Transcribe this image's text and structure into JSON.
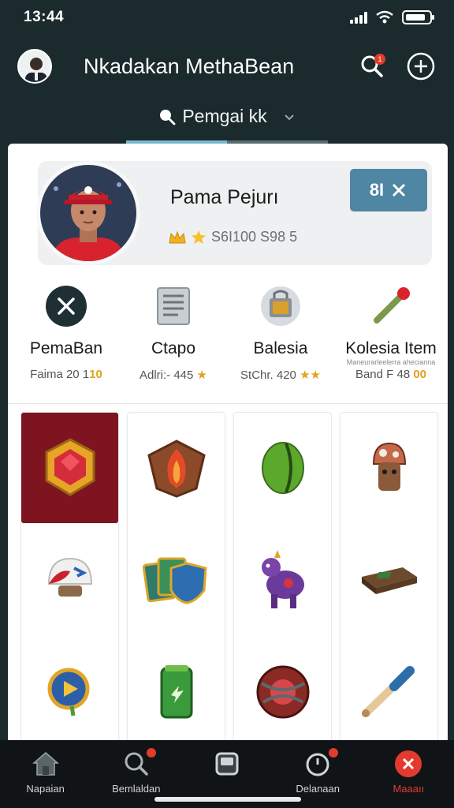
{
  "status": {
    "time": "13:44"
  },
  "header": {
    "title": "Nkadakan MethaBean",
    "notif_badge": "1"
  },
  "search": {
    "label": "Pemgai kk"
  },
  "profile": {
    "name": "Pama Pejurı",
    "stats": "S6I100 S98 5",
    "action_label": "8I"
  },
  "categories": [
    {
      "name": "PemaBan",
      "sub": "Faima 20 1",
      "sub_accent": "10",
      "icon": "close-circle-icon"
    },
    {
      "name": "Ctapo",
      "sub": "Adlri:- 445",
      "sub_accent": "★",
      "icon": "document-icon"
    },
    {
      "name": "Balesia",
      "sub": "StChr. 420",
      "sub_accent": "★★",
      "icon": "vault-icon"
    },
    {
      "name": "Kolesia Item",
      "sub": "Band F 48",
      "sub_accent": "00",
      "sub_small": "Maneurarleelerra ahecianna",
      "icon": "cricket-bat-icon"
    }
  ],
  "items": [
    {
      "icon": "gold-emblem-icon",
      "selected": true
    },
    {
      "icon": "flame-shield-icon"
    },
    {
      "icon": "green-ball-icon"
    },
    {
      "icon": "mushroom-figure-icon"
    },
    {
      "icon": "helmet-icon"
    },
    {
      "icon": "card-shield-icon"
    },
    {
      "icon": "purple-creature-icon"
    },
    {
      "icon": "wooden-board-icon"
    },
    {
      "icon": "medal-icon"
    },
    {
      "icon": "green-can-icon"
    },
    {
      "icon": "red-ball-icon"
    },
    {
      "icon": "bat-icon"
    }
  ],
  "bottom_nav": [
    {
      "label": "Napaian",
      "icon": "home-icon"
    },
    {
      "label": "Bemlaldan",
      "icon": "search-icon",
      "badge": true
    },
    {
      "label": "",
      "icon": "square-icon"
    },
    {
      "label": "Delanaan",
      "icon": "timer-icon",
      "badge": true
    },
    {
      "label": "Maaaıı",
      "icon": "close-badge-icon",
      "active": true
    }
  ],
  "colors": {
    "background": "#1b2a2c",
    "accent_red": "#e23b2e",
    "selected_tile": "#7d1420",
    "action_blue": "#4e86a4"
  }
}
